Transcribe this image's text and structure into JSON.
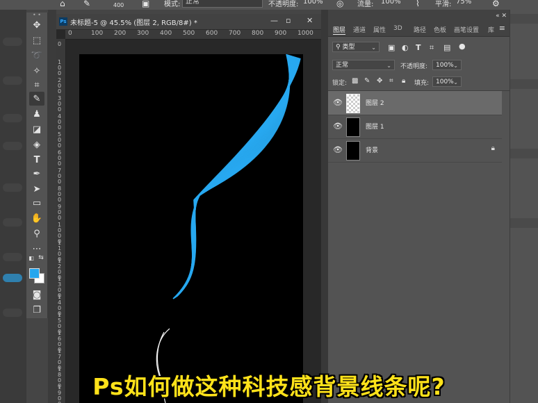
{
  "options_bar": {
    "mode_label": "模式:",
    "mode_value": "正常",
    "opacity_label": "不透明度:",
    "opacity_value": "100%",
    "flow_label": "流量:",
    "flow_value": "100%",
    "smooth_label": "平滑:",
    "smooth_value": "75%",
    "brush_size": "400"
  },
  "document": {
    "title": "未标题-5 @ 45.5% (图层 2, RGB/8#) *",
    "app_badge": "Ps",
    "ruler_h_ticks": [
      "0",
      "100",
      "200",
      "300",
      "400",
      "500",
      "600",
      "700",
      "800",
      "900",
      "1000",
      "11"
    ],
    "ruler_v_ticks": [
      "0",
      "100",
      "200",
      "300",
      "400",
      "500",
      "600",
      "700",
      "800",
      "900",
      "1000",
      "1100",
      "1200",
      "1300",
      "1400",
      "1500",
      "1600",
      "1700",
      "1800",
      "1900"
    ],
    "colors": {
      "foreground": "#26a6ee",
      "background": "#ffffff",
      "lines": "#28a9f0"
    }
  },
  "layers_panel": {
    "tabs": [
      "图层",
      "通道",
      "属性",
      "3D",
      "路径",
      "色板",
      "画笔设置",
      "库"
    ],
    "filter_value": "类型",
    "blend_value": "正常",
    "opacity_label": "不透明度:",
    "opacity_value": "100%",
    "lock_label": "锁定:",
    "fill_label": "填充:",
    "fill_value": "100%",
    "layers": [
      {
        "name": "图层 2",
        "selected": true,
        "thumbnail": "transparent"
      },
      {
        "name": "图层 1",
        "selected": false,
        "thumbnail": "black"
      },
      {
        "name": "背景",
        "selected": false,
        "thumbnail": "black",
        "locked": true
      }
    ]
  },
  "caption": "Ps如何做这种科技感背景线条呢?"
}
